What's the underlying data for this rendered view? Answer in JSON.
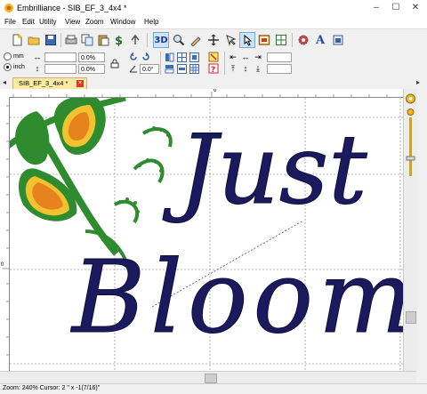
{
  "window": {
    "title": "Embrilliance - SIB_EF_3_4x4 *",
    "minimize": "–",
    "maximize": "☐",
    "close": "✕"
  },
  "menu": [
    "File",
    "Edit",
    "Utility",
    "View",
    "Zoom",
    "Window",
    "Help"
  ],
  "toolbar": {
    "three_d_label": "3D",
    "font_letter": "A"
  },
  "properties": {
    "unit_mm": "mm",
    "unit_inch": "inch",
    "selected_unit": "inch",
    "width_value": "",
    "height_value": "",
    "width_percent": "0.0%",
    "height_percent": "0.0%",
    "rotation": "0.0°"
  },
  "document": {
    "tab_label": "SIB_EF_3_4x4 *",
    "ruler_top_zero": "0",
    "ruler_left_zero": "0"
  },
  "design": {
    "text_line1": "Just",
    "text_line2": "Bloom",
    "text_color": "#1c1a5e",
    "leaf_color": "#2e8b2e",
    "flower_orange": "#e8821e",
    "flower_yellow": "#f2c230"
  },
  "status": {
    "text": "Zoom: 240%  Cursor: 2 \" x -1(7/16)\""
  }
}
